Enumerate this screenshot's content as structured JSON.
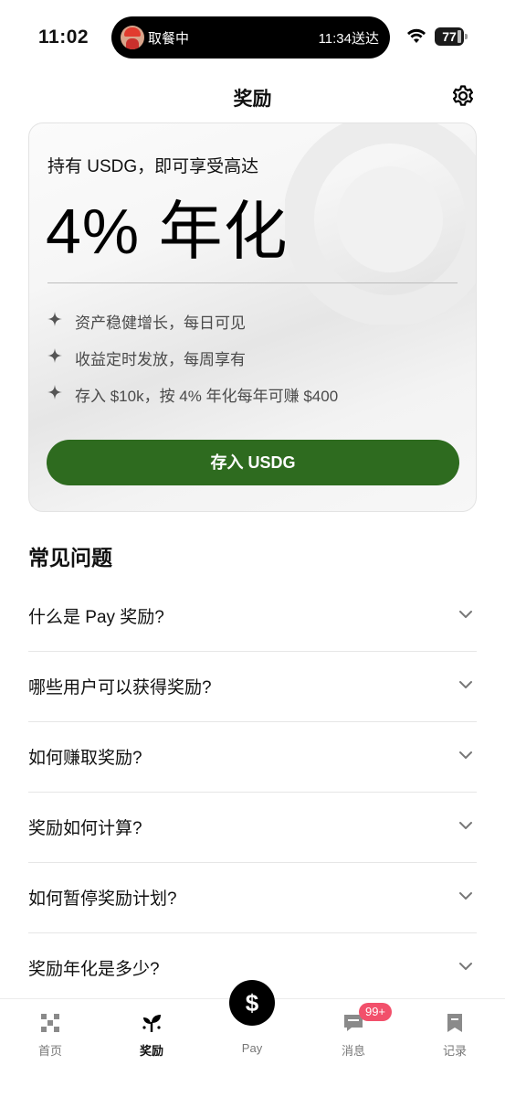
{
  "status_bar": {
    "time": "11:02",
    "live_activity_left": "取餐中",
    "live_activity_right": "11:34送达",
    "battery": "77"
  },
  "header": {
    "title": "奖励"
  },
  "promo": {
    "subtitle": "持有 USDG，即可享受高达",
    "headline": "4% 年化",
    "benefits": [
      "资产稳健增长，每日可见",
      "收益定时发放，每周享有",
      "存入 $10k，按 4% 年化每年可赚 $400"
    ],
    "cta": "存入 USDG",
    "cta_color": "#2e6b1f"
  },
  "faq": {
    "title": "常见问题",
    "items": [
      "什么是 Pay 奖励?",
      "哪些用户可以获得奖励?",
      "如何赚取奖励?",
      "奖励如何计算?",
      "如何暂停奖励计划?",
      "奖励年化是多少?"
    ]
  },
  "tab_bar": {
    "tabs": [
      {
        "label": "首页",
        "icon": "home-grid-icon"
      },
      {
        "label": "奖励",
        "icon": "rewards-sprout-icon"
      },
      {
        "label": "Pay",
        "icon": "dollar-icon",
        "symbol": "$"
      },
      {
        "label": "消息",
        "icon": "message-icon"
      },
      {
        "label": "记录",
        "icon": "records-icon"
      }
    ],
    "message_badge": "99+",
    "badge_color": "#f2506b"
  }
}
